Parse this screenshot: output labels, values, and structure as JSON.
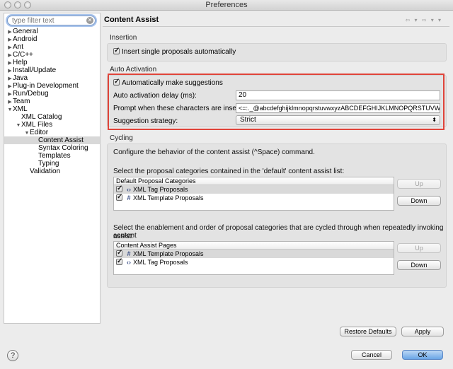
{
  "window": {
    "title": "Preferences"
  },
  "sidebar": {
    "search_placeholder": "type filter text",
    "items": [
      {
        "label": "General",
        "depth": 0,
        "arrow": "collapsed"
      },
      {
        "label": "Android",
        "depth": 0,
        "arrow": "collapsed"
      },
      {
        "label": "Ant",
        "depth": 0,
        "arrow": "collapsed"
      },
      {
        "label": "C/C++",
        "depth": 0,
        "arrow": "collapsed"
      },
      {
        "label": "Help",
        "depth": 0,
        "arrow": "collapsed"
      },
      {
        "label": "Install/Update",
        "depth": 0,
        "arrow": "collapsed"
      },
      {
        "label": "Java",
        "depth": 0,
        "arrow": "collapsed"
      },
      {
        "label": "Plug-in Development",
        "depth": 0,
        "arrow": "collapsed"
      },
      {
        "label": "Run/Debug",
        "depth": 0,
        "arrow": "collapsed"
      },
      {
        "label": "Team",
        "depth": 0,
        "arrow": "collapsed"
      },
      {
        "label": "XML",
        "depth": 0,
        "arrow": "expanded"
      },
      {
        "label": "XML Catalog",
        "depth": 1,
        "arrow": "none"
      },
      {
        "label": "XML Files",
        "depth": 1,
        "arrow": "expanded"
      },
      {
        "label": "Editor",
        "depth": 2,
        "arrow": "expanded"
      },
      {
        "label": "Content Assist",
        "depth": 3,
        "arrow": "none",
        "selected": true
      },
      {
        "label": "Syntax Coloring",
        "depth": 3,
        "arrow": "none"
      },
      {
        "label": "Templates",
        "depth": 3,
        "arrow": "none"
      },
      {
        "label": "Typing",
        "depth": 3,
        "arrow": "none"
      },
      {
        "label": "Validation",
        "depth": 2,
        "arrow": "none"
      }
    ]
  },
  "main": {
    "title": "Content Assist",
    "insertion": {
      "label": "Insertion",
      "single_proposals": "Insert single proposals automatically"
    },
    "auto_activation": {
      "label": "Auto Activation",
      "make_suggestions": "Automatically make suggestions",
      "delay_label": "Auto activation delay (ms):",
      "delay_value": "20",
      "prompt_label": "Prompt when these characters are inserted:",
      "prompt_value": "<=:._@abcdefghijklmnopqrstuvwxyzABCDEFGHIJKLMNOPQRSTUVWXYZ",
      "strategy_label": "Suggestion strategy:",
      "strategy_value": "Strict"
    },
    "cycling": {
      "label": "Cycling",
      "description": "Configure the behavior of the content assist (^Space) command.",
      "default_label": "Select the proposal categories contained in the 'default' content assist list:",
      "default_header": "Default Proposal Categories",
      "default_items": [
        {
          "icon": "‹›",
          "label": "XML Tag Proposals"
        },
        {
          "icon": "#",
          "label": "XML Template Proposals"
        }
      ],
      "enablement_label_1": "Select the enablement and order of proposal categories that are cycled through when repeatedly invoking content",
      "enablement_label_2": "assist:",
      "pages_header": "Content Assist Pages",
      "pages_items": [
        {
          "icon": "#",
          "label": "XML Template Proposals"
        },
        {
          "icon": "‹›",
          "label": "XML Tag Proposals"
        }
      ],
      "up": "Up",
      "down": "Down"
    },
    "restore_defaults": "Restore Defaults",
    "apply": "Apply"
  },
  "footer": {
    "help": "?",
    "cancel": "Cancel",
    "ok": "OK"
  },
  "colors": {
    "highlight": "#e0443a",
    "primary_button": "#6aa5e6"
  }
}
